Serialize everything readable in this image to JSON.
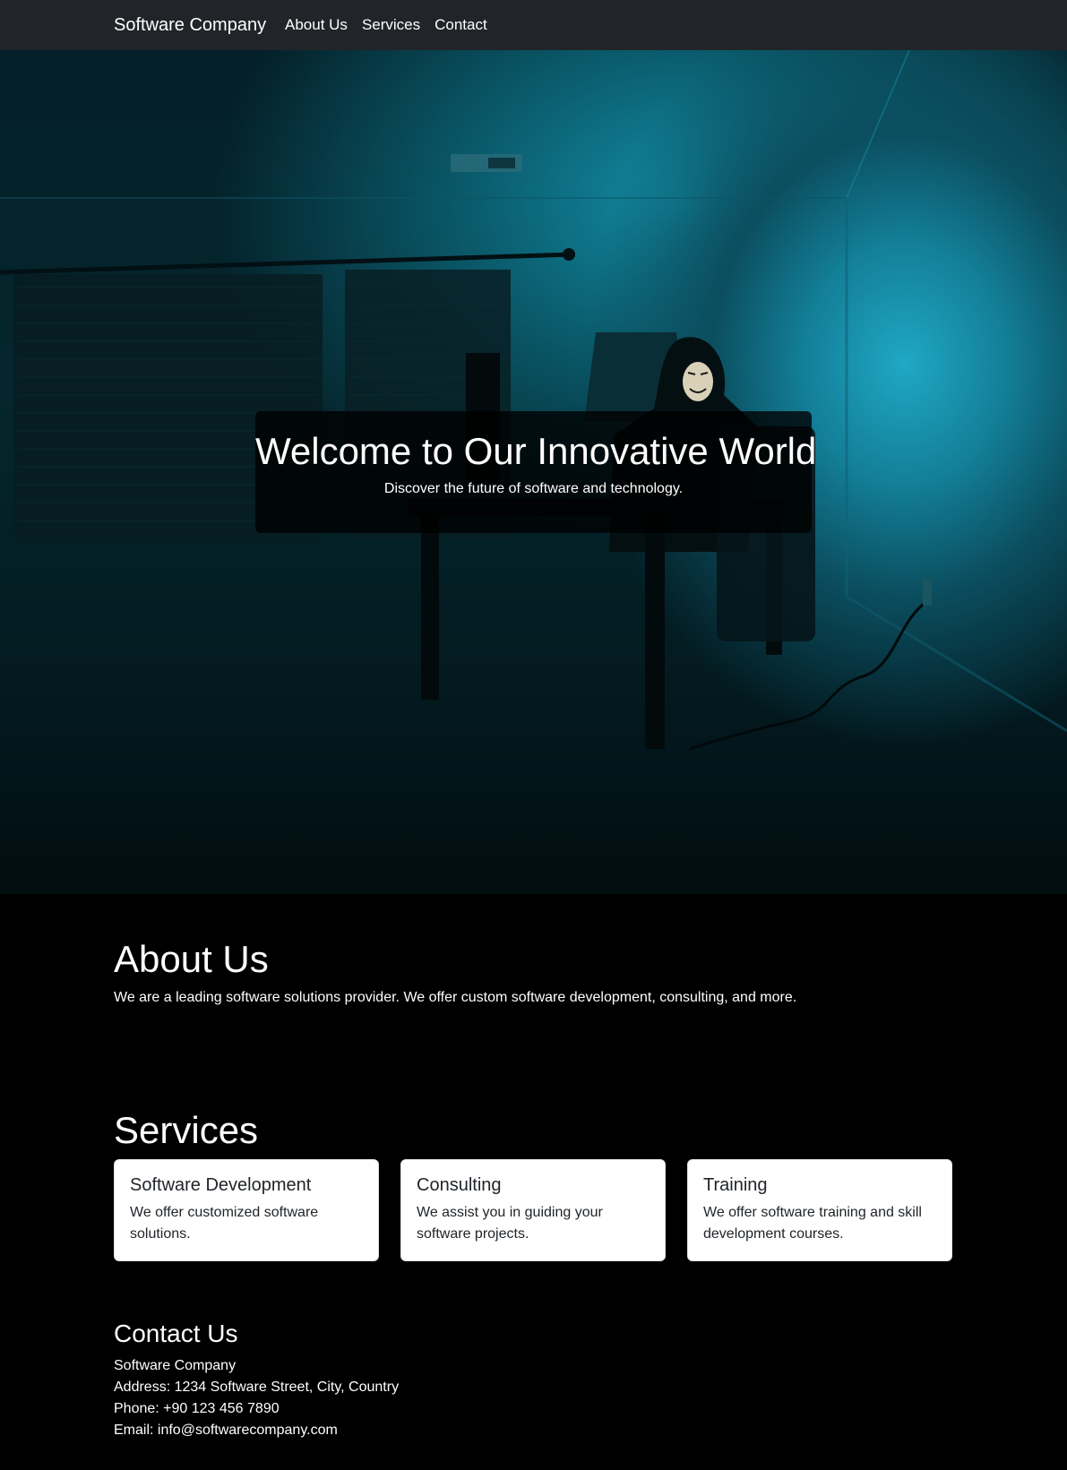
{
  "navbar": {
    "brand": "Software Company",
    "links": [
      "About Us",
      "Services",
      "Contact"
    ],
    "background_color": "#212529"
  },
  "hero": {
    "title": "Welcome to Our Innovative World",
    "subtitle": "Discover the future of software and technology.",
    "background_image": "dark room lit in teal with a hooded person in a mask sitting at a desk with a computer monitor and lamp"
  },
  "about": {
    "heading": "About Us",
    "text": "We are a leading software solutions provider. We offer custom software development, consulting, and more."
  },
  "services": {
    "heading": "Services",
    "cards": [
      {
        "title": "Software Development",
        "text": "We offer customized software solutions."
      },
      {
        "title": "Consulting",
        "text": "We assist you in guiding your software projects."
      },
      {
        "title": "Training",
        "text": "We offer software training and skill development courses."
      }
    ]
  },
  "contact": {
    "heading": "Contact Us",
    "company": "Software Company",
    "address": "Address: 1234 Software Street, City, Country",
    "phone": "Phone: +90 123 456 7890",
    "email": "Email: info@softwarecompany.com"
  },
  "colors": {
    "page_background": "#000000",
    "text": "#ffffff",
    "card_background": "#ffffff",
    "card_text": "#212529",
    "hero_accent": "#1fa8c4"
  }
}
